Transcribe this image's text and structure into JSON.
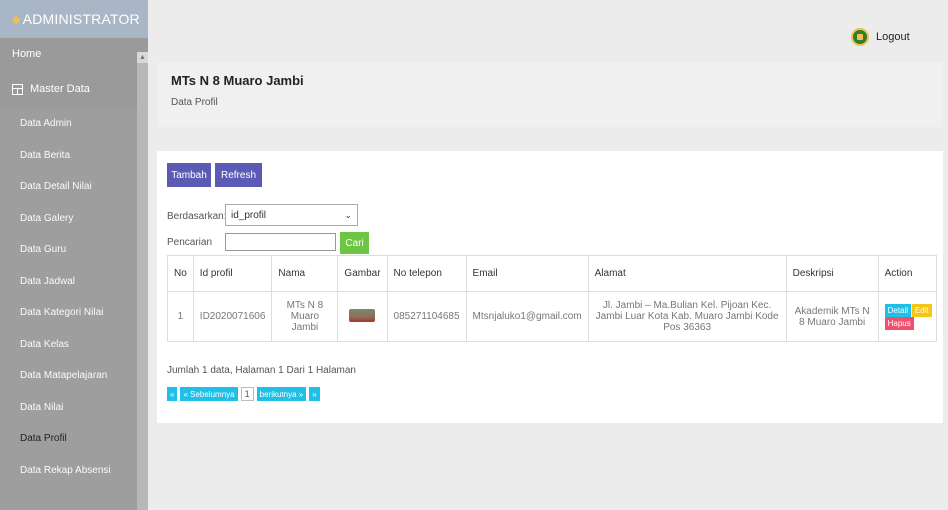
{
  "sidebar": {
    "brand": "ADMINISTRATOR",
    "home": "Home",
    "master": "Master Data",
    "items": [
      {
        "label": "Data Admin"
      },
      {
        "label": "Data Berita"
      },
      {
        "label": "Data Detail Nilai"
      },
      {
        "label": "Data Galery"
      },
      {
        "label": "Data Guru"
      },
      {
        "label": "Data Jadwal"
      },
      {
        "label": "Data Kategori Nilai"
      },
      {
        "label": "Data Kelas"
      },
      {
        "label": "Data Matapelajaran"
      },
      {
        "label": "Data Nilai"
      },
      {
        "label": "Data Profil"
      },
      {
        "label": "Data Rekap Absensi"
      }
    ],
    "active": "Data Profil"
  },
  "topbar": {
    "logout": "Logout"
  },
  "header": {
    "title": "MTs N 8 Muaro Jambi",
    "subtitle": "Data Profil"
  },
  "toolbar": {
    "tambah": "Tambah",
    "refresh": "Refresh"
  },
  "filter": {
    "berdasarkan_label": "Berdasarkan:",
    "berdasarkan_value": "id_profil",
    "pencarian_label": "Pencarian",
    "search_value": "",
    "cari": "Cari"
  },
  "table": {
    "headers": [
      "No",
      "Id profil",
      "Nama",
      "Gambar",
      "No telepon",
      "Email",
      "Alamat",
      "Deskripsi",
      "Action"
    ],
    "rows": [
      {
        "no": "1",
        "id": "ID2020071606",
        "nama": "MTs N 8 Muaro Jambi",
        "telepon": "085271104685",
        "email": "Mtsnjaluko1@gmail.com",
        "alamat": "Jl. Jambi – Ma.Bulian Kel. Pijoan Kec. Jambi Luar Kota Kab. Muaro Jambi Kode Pos 36363",
        "deskripsi": "Akademik MTs N 8 Muaro Jambi"
      }
    ],
    "actions": {
      "detail": "Detail",
      "edit": "Edit",
      "hapus": "Hapus"
    }
  },
  "summary": "Jumlah 1 data, Halaman 1 Dari 1 Halaman",
  "pager": {
    "first": "«",
    "prev": "« Sebelumnya",
    "page": "1",
    "next": "berikutnya »",
    "last": "»"
  },
  "colors": {
    "sidebar": "#9e9e9e",
    "brand": "#a9b6c6",
    "primary_button": "#5b5bb5",
    "cari": "#6cc644",
    "detail": "#1fc0e8",
    "edit": "#f5c518",
    "hapus": "#f0506e"
  }
}
